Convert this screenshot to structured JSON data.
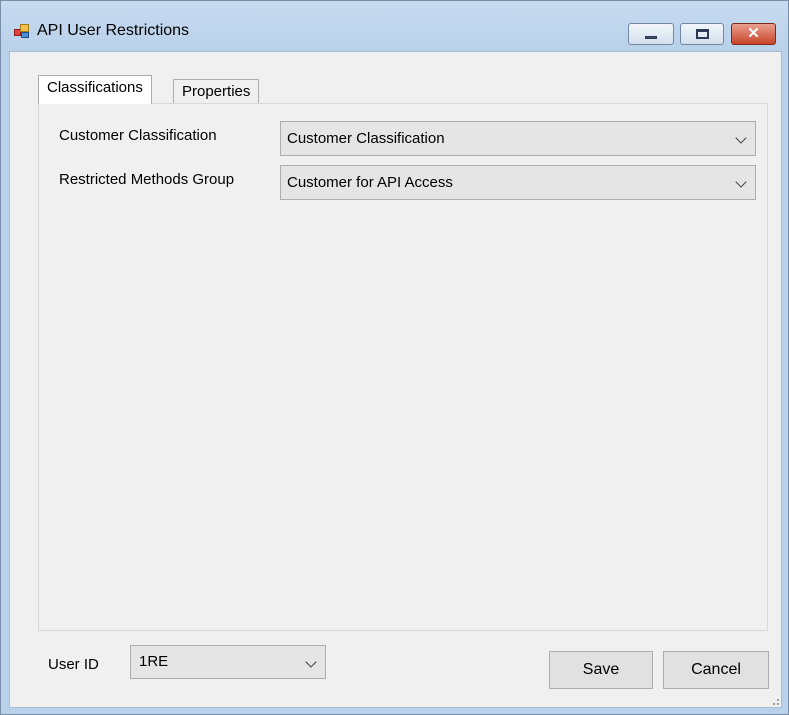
{
  "window": {
    "title": "API User Restrictions",
    "close_symbol": "✕"
  },
  "tabs": [
    {
      "label": "Classifications",
      "selected": true
    },
    {
      "label": "Properties",
      "selected": false
    }
  ],
  "fields": {
    "customer_classification": {
      "label": "Customer Classification",
      "value": "Customer Classification"
    },
    "restricted_methods_group": {
      "label": "Restricted Methods Group",
      "value": "Customer for API Access"
    }
  },
  "footer": {
    "user_id_label": "User ID",
    "user_id_value": "1RE",
    "save_label": "Save",
    "cancel_label": "Cancel"
  },
  "icons": {
    "app": "app-icon",
    "minimize": "minimize-icon",
    "maximize": "maximize-icon",
    "close": "close-icon",
    "dropdown": "chevron-down-icon",
    "grip": "resize-grip-icon"
  },
  "colors": {
    "window_frame": "#b9d1ea",
    "client_bg": "#f0f0f0",
    "close_button": "#c94429"
  }
}
